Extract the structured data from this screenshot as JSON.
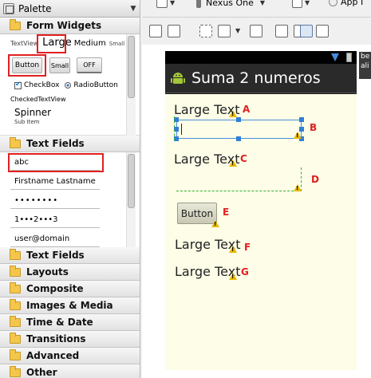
{
  "palette": {
    "title": "Palette",
    "form_widgets": {
      "title": "Form Widgets",
      "textview": "TextView",
      "large": "Large",
      "medium": "Medium",
      "small": "Small",
      "button": "Button",
      "small_button": "Small",
      "toggle": "OFF",
      "checkbox": "CheckBox",
      "radio": "RadioButton",
      "checked_tv": "CheckedTextView",
      "spinner": "Spinner",
      "sub_item": "Sub Item"
    },
    "text_fields": {
      "title": "Text Fields",
      "fields": [
        "abc",
        "Firstname Lastname",
        "••••••••",
        "1•••2•••3",
        "user@domain"
      ]
    },
    "categories": [
      "Text Fields",
      "Layouts",
      "Composite",
      "Images & Media",
      "Time & Date",
      "Transitions",
      "Advanced",
      "Other"
    ]
  },
  "toolbar": {
    "device": "Nexus One",
    "app": "App I"
  },
  "device": {
    "app_title": "Suma 2 numeros",
    "side_text": "be ali"
  },
  "layout": {
    "large_text": "Large Text",
    "button": "Button",
    "labels": [
      "A",
      "B",
      "C",
      "D",
      "E",
      "F",
      "G"
    ]
  },
  "colors": {
    "annotation": "#e02020",
    "selection": "#2f7fd6",
    "guide": "#35b035"
  }
}
